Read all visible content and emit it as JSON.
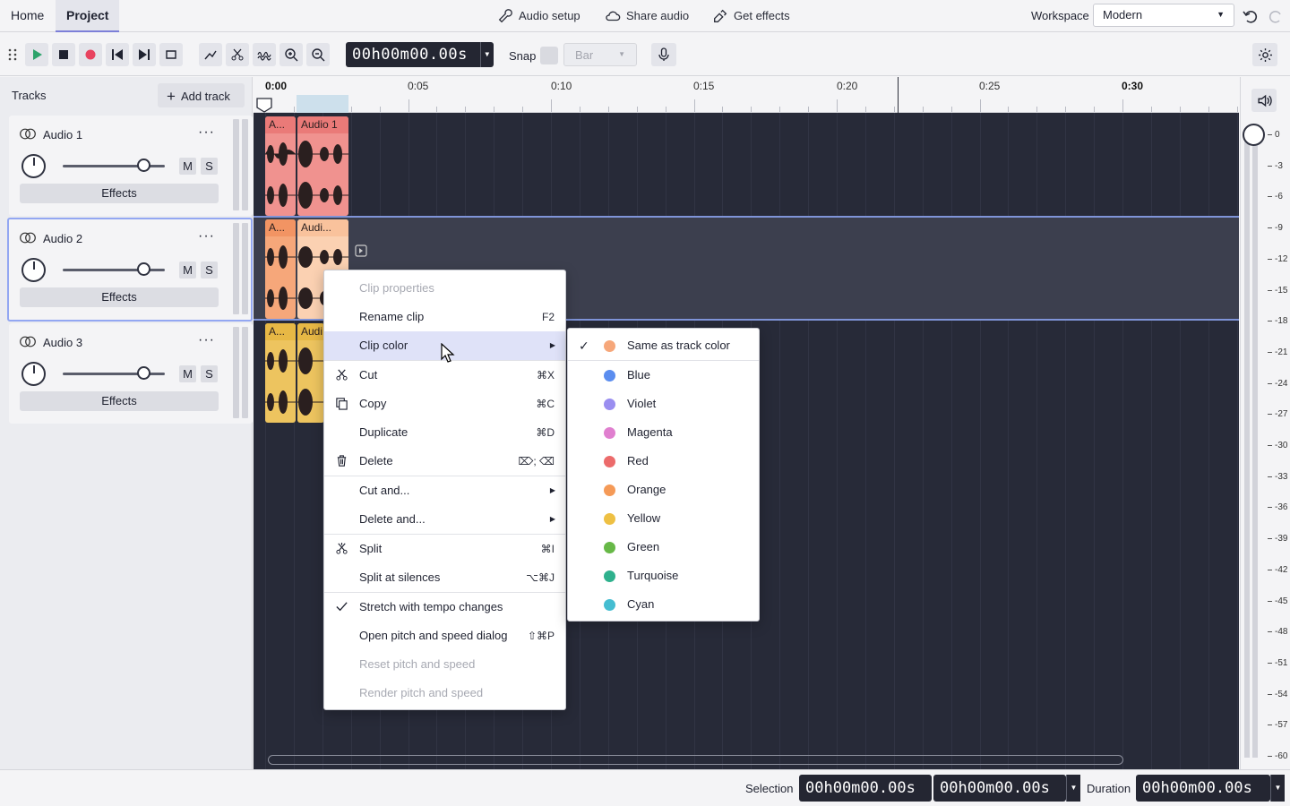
{
  "nav": {
    "tabs": [
      "Home",
      "Project"
    ]
  },
  "top_actions": {
    "audio_setup": "Audio setup",
    "share_audio": "Share audio",
    "get_effects": "Get effects"
  },
  "workspace": {
    "label": "Workspace",
    "value": "Modern"
  },
  "toolbar": {
    "time": "00h00m00.00s",
    "snap_label": "Snap",
    "snap_unit": "Bar"
  },
  "tracks_panel": {
    "title": "Tracks",
    "add_track": "Add track",
    "tracks": [
      {
        "name": "Audio 1",
        "mute": "M",
        "solo": "S",
        "effects": "Effects",
        "color": "#f0928f"
      },
      {
        "name": "Audio 2",
        "mute": "M",
        "solo": "S",
        "effects": "Effects",
        "color": "#f6a77a"
      },
      {
        "name": "Audio 3",
        "mute": "M",
        "solo": "S",
        "effects": "Effects",
        "color": "#edc45f"
      }
    ]
  },
  "ruler": {
    "labels": [
      "0:00",
      "0:05",
      "0:10",
      "0:15",
      "0:20",
      "0:25",
      "0:30"
    ]
  },
  "clips": [
    {
      "short": "A...",
      "name": "Audio 1"
    },
    {
      "short": "A...",
      "name": "Audi..."
    },
    {
      "short": "A...",
      "name": "Audi"
    }
  ],
  "meter": {
    "db_labels": [
      "0",
      "-3",
      "-6",
      "-9",
      "-12",
      "-15",
      "-18",
      "-21",
      "-24",
      "-27",
      "-30",
      "-33",
      "-36",
      "-39",
      "-42",
      "-45",
      "-48",
      "-51",
      "-54",
      "-57",
      "-60"
    ]
  },
  "bottom": {
    "selection_label": "Selection",
    "sel_start": "00h00m00.00s",
    "sel_end": "00h00m00.00s",
    "duration_label": "Duration",
    "duration": "00h00m00.00s"
  },
  "context_menu": {
    "clip_properties": "Clip properties",
    "rename_clip": "Rename clip",
    "rename_sc": "F2",
    "clip_color": "Clip color",
    "cut": "Cut",
    "cut_sc": "⌘X",
    "copy": "Copy",
    "copy_sc": "⌘C",
    "duplicate": "Duplicate",
    "duplicate_sc": "⌘D",
    "delete": "Delete",
    "delete_sc": "⌦; ⌫",
    "cut_and": "Cut and...",
    "delete_and": "Delete and...",
    "split": "Split",
    "split_sc": "⌘I",
    "split_silences": "Split at silences",
    "split_silences_sc": "⌥⌘J",
    "stretch": "Stretch with tempo changes",
    "pitch_dialog": "Open pitch and speed dialog",
    "pitch_dialog_sc": "⇧⌘P",
    "reset_pitch": "Reset pitch and speed",
    "render_pitch": "Render pitch and speed"
  },
  "color_menu": [
    {
      "label": "Same as track color",
      "color": "#f6a77a"
    },
    {
      "label": "Blue",
      "color": "#5b8def"
    },
    {
      "label": "Violet",
      "color": "#9a8ef0"
    },
    {
      "label": "Magenta",
      "color": "#e07fcf"
    },
    {
      "label": "Red",
      "color": "#ec6b6b"
    },
    {
      "label": "Orange",
      "color": "#f59a57"
    },
    {
      "label": "Yellow",
      "color": "#eec043"
    },
    {
      "label": "Green",
      "color": "#67b847"
    },
    {
      "label": "Turquoise",
      "color": "#2fb18d"
    },
    {
      "label": "Cyan",
      "color": "#45bdd1"
    }
  ]
}
